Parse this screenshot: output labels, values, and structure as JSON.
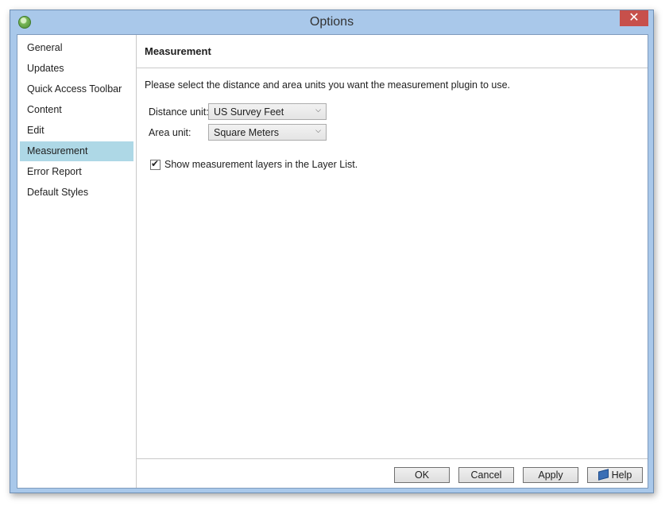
{
  "window": {
    "title": "Options",
    "close_label": "✕",
    "app_icon": "app-icon",
    "close_icon": "close-icon"
  },
  "sidebar": {
    "items": [
      {
        "label": "General",
        "selected": false
      },
      {
        "label": "Updates",
        "selected": false
      },
      {
        "label": "Quick Access Toolbar",
        "selected": false
      },
      {
        "label": "Content",
        "selected": false
      },
      {
        "label": "Edit",
        "selected": false
      },
      {
        "label": "Measurement",
        "selected": true
      },
      {
        "label": "Error Report",
        "selected": false
      },
      {
        "label": "Default Styles",
        "selected": false
      }
    ]
  },
  "main": {
    "title": "Measurement",
    "description": "Please select the distance and area units you want the measurement plugin to use.",
    "distance": {
      "label": "Distance unit:",
      "value": "US Survey Feet"
    },
    "area": {
      "label": "Area unit:",
      "value": "Square Meters"
    },
    "show_layers": {
      "label": "Show measurement layers in the Layer List.",
      "checked": true
    }
  },
  "footer": {
    "ok": "OK",
    "cancel": "Cancel",
    "apply": "Apply",
    "help": "Help",
    "help_icon": "book-icon"
  },
  "colors": {
    "selected_item": "#aed8e6",
    "close_button": "#c7504b",
    "frame": "#a9c8ea"
  }
}
